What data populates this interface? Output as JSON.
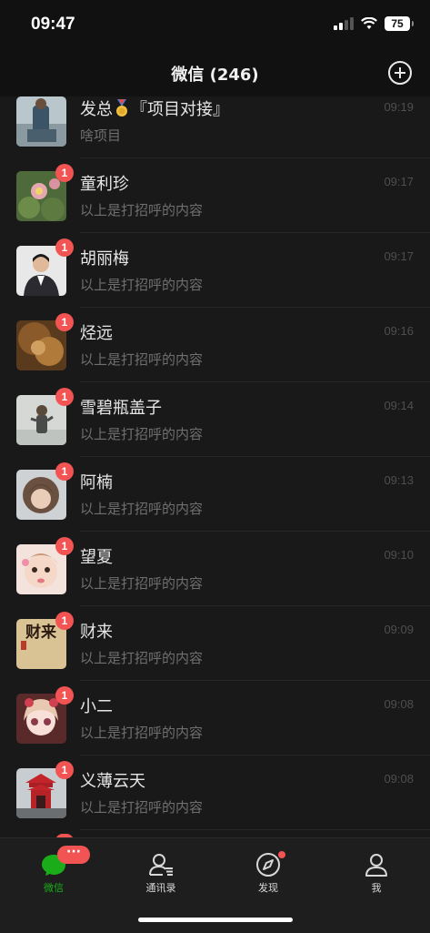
{
  "status": {
    "time": "09:47",
    "battery": "75"
  },
  "header": {
    "title": "微信 (246)"
  },
  "chats": [
    {
      "name": "发总",
      "name_suffix": "『项目对接』",
      "message": "啥项目",
      "time": "09:19",
      "badge": ""
    },
    {
      "name": "童利珍",
      "message": "以上是打招呼的内容",
      "time": "09:17",
      "badge": "1"
    },
    {
      "name": "胡丽梅",
      "message": "以上是打招呼的内容",
      "time": "09:17",
      "badge": "1"
    },
    {
      "name": "烃远",
      "message": "以上是打招呼的内容",
      "time": "09:16",
      "badge": "1"
    },
    {
      "name": "雪碧瓶盖子",
      "message": "以上是打招呼的内容",
      "time": "09:14",
      "badge": "1"
    },
    {
      "name": "阿楠",
      "message": "以上是打招呼的内容",
      "time": "09:13",
      "badge": "1"
    },
    {
      "name": "望夏",
      "message": "以上是打招呼的内容",
      "time": "09:10",
      "badge": "1"
    },
    {
      "name": "财来",
      "message": "以上是打招呼的内容",
      "time": "09:09",
      "badge": "1",
      "avatar_text": "财来"
    },
    {
      "name": "小二",
      "message": "以上是打招呼的内容",
      "time": "09:08",
      "badge": "1"
    },
    {
      "name": "义薄云天",
      "message": "以上是打招呼的内容",
      "time": "09:08",
      "badge": "1"
    }
  ],
  "tabs": [
    {
      "label": "微信",
      "icon": "chat-bubble-icon",
      "badge": "···",
      "active": true
    },
    {
      "label": "通讯录",
      "icon": "contacts-icon"
    },
    {
      "label": "发现",
      "icon": "compass-icon",
      "dot": true
    },
    {
      "label": "我",
      "icon": "person-icon"
    }
  ],
  "colors": {
    "accent": "#1aad19",
    "badge": "#f25454",
    "background": "#191919"
  }
}
